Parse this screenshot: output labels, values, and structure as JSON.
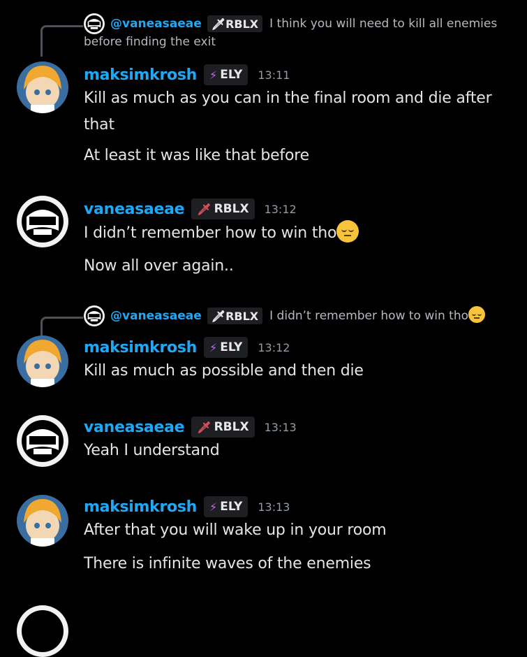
{
  "messages": [
    {
      "reply": {
        "name": "@vaneasaeae",
        "tag": "RBLX",
        "text_line1": "I think you will need to kill all enemies",
        "text_line2": "before finding the exit"
      },
      "username": "maksimkrosh",
      "tag": "ELY",
      "time": "13:11",
      "lines": [
        "Kill as much as you can in the final room and die after",
        "that",
        "At least it was like that before"
      ]
    },
    {
      "username": "vaneasaeae",
      "tag": "RBLX",
      "time": "13:12",
      "lines": [
        "I didn’t remember how to win tho",
        "Now all over again.."
      ]
    },
    {
      "reply": {
        "name": "@vaneasaeae",
        "tag": "RBLX",
        "text_line1": "I didn’t remember how to win tho"
      },
      "username": "maksimkrosh",
      "tag": "ELY",
      "time": "13:12",
      "lines": [
        "Kill as much as possible and then die"
      ]
    },
    {
      "username": "vaneasaeae",
      "tag": "RBLX",
      "time": "13:13",
      "lines": [
        "Yeah I understand"
      ]
    },
    {
      "username": "maksimkrosh",
      "tag": "ELY",
      "time": "13:13",
      "lines": [
        "After that you will wake up in your room",
        "There is infinite waves of the enemies"
      ]
    }
  ],
  "icons": {
    "tag_ely": "lightning-bolt-icon",
    "tag_rblx": "sword-icon",
    "emoji": "pensive-face-emoji"
  },
  "colors": {
    "background": "#000000",
    "username": "#1ea8f5",
    "text": "#e3e5e8",
    "timestamp": "#949ba4",
    "tag_bg": "#1e1f22"
  }
}
